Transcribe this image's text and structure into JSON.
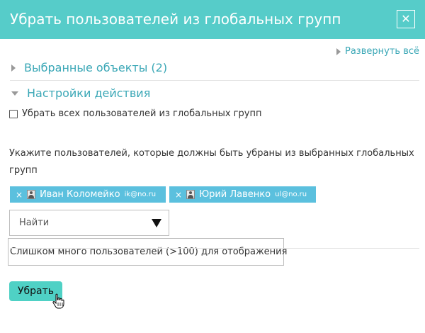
{
  "dialog": {
    "title": "Убрать пользователей из глобальных групп",
    "close_label": "✕"
  },
  "expand_all": "Развернуть всё",
  "sections": [
    {
      "label": "Выбранные объекты (2)",
      "expanded": false
    },
    {
      "label": "Настройки действия",
      "expanded": true
    }
  ],
  "remove_all_checkbox": {
    "label": "Убрать всех пользователей из глобальных групп",
    "checked": false
  },
  "instruction": "Укажите пользователей, которые должны быть убраны из выбранных глобальных групп",
  "selected_users": [
    {
      "remove": "×",
      "name": "Иван Коломейко",
      "email": "ik@no.ru"
    },
    {
      "remove": "×",
      "name": "Юрий Лавенко",
      "email": "ul@no.ru"
    }
  ],
  "search": {
    "placeholder": "Найти"
  },
  "too_many_message": "Слишком много пользователей (>100) для отображения",
  "submit_label": "Убрать",
  "colors": {
    "header": "#56ccc9",
    "link": "#3aa7b6",
    "chip": "#5bc0de",
    "button": "#4fd1c5"
  }
}
